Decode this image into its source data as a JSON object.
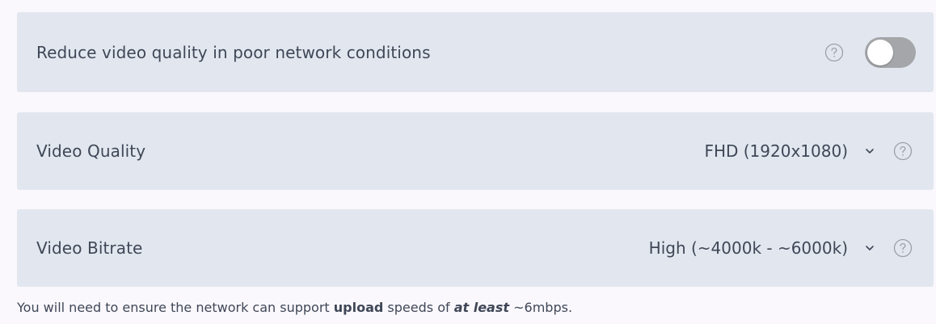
{
  "network_row": {
    "label": "Reduce video quality in poor network conditions",
    "toggle_on": false
  },
  "quality_row": {
    "label": "Video Quality",
    "selected": "FHD (1920x1080)"
  },
  "bitrate_row": {
    "label": "Video Bitrate",
    "selected": "High (~4000k - ~6000k)"
  },
  "note": {
    "part1": "You will need to ensure the network can support ",
    "bold": "upload",
    "part2": " speeds of ",
    "emphasis": "at least",
    "part3": " ~6mbps."
  },
  "icons": {
    "help": "help-circle-icon",
    "chevron": "chevron-down-icon"
  },
  "colors": {
    "row_background": "#e2e7ef",
    "page_background": "#faf8fd",
    "text": "#3f4757",
    "toggle_off": "#a4a6aa"
  }
}
